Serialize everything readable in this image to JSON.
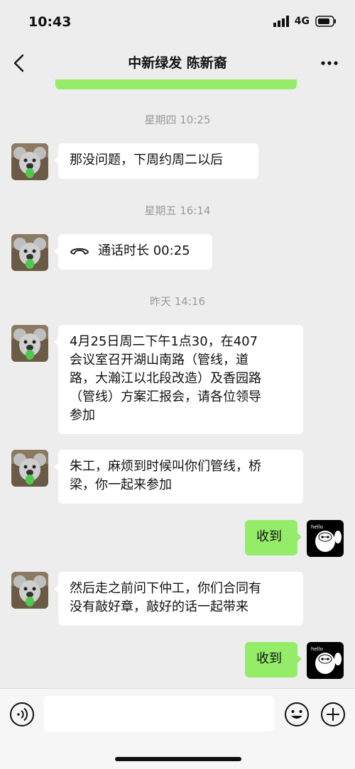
{
  "status_bar": {
    "time": "10:43",
    "network": "4G"
  },
  "header": {
    "title": "中新绿发 陈新裔"
  },
  "messages": [
    {
      "type": "timestamp",
      "text": "星期四 10:25"
    },
    {
      "type": "text",
      "sender": "other",
      "text": "那没问题，下周约周二以后"
    },
    {
      "type": "timestamp",
      "text": "星期五 16:14"
    },
    {
      "type": "call",
      "sender": "other",
      "text": "通话时长 00:25"
    },
    {
      "type": "timestamp",
      "text": "昨天 14:16"
    },
    {
      "type": "text",
      "sender": "other",
      "lines": [
        "4月25日周二下午1点30，在407",
        "会议室召开湖山南路（管线，道",
        "路，大瀚江以北段改造）及香园路",
        "（管线）方案汇报会，请各位领导",
        "参加"
      ]
    },
    {
      "type": "text",
      "sender": "other",
      "lines": [
        "朱工，麻烦到时候叫你们管线，桥",
        "梁，你一起来参加"
      ]
    },
    {
      "type": "text",
      "sender": "me",
      "text": "收到"
    },
    {
      "type": "text",
      "sender": "other",
      "lines": [
        "然后走之前问下仲工，你们合同有",
        "没有敲好章，敲好的话一起带来"
      ]
    },
    {
      "type": "text",
      "sender": "me",
      "text": "收到"
    }
  ],
  "colors": {
    "background": "#ededed",
    "my_bubble": "#95ec69",
    "other_bubble": "#ffffff",
    "timestamp": "#9a9a9a"
  },
  "icons": [
    "back-icon",
    "more-icon",
    "phone-icon",
    "voice-icon",
    "emoji-icon",
    "plus-icon"
  ]
}
